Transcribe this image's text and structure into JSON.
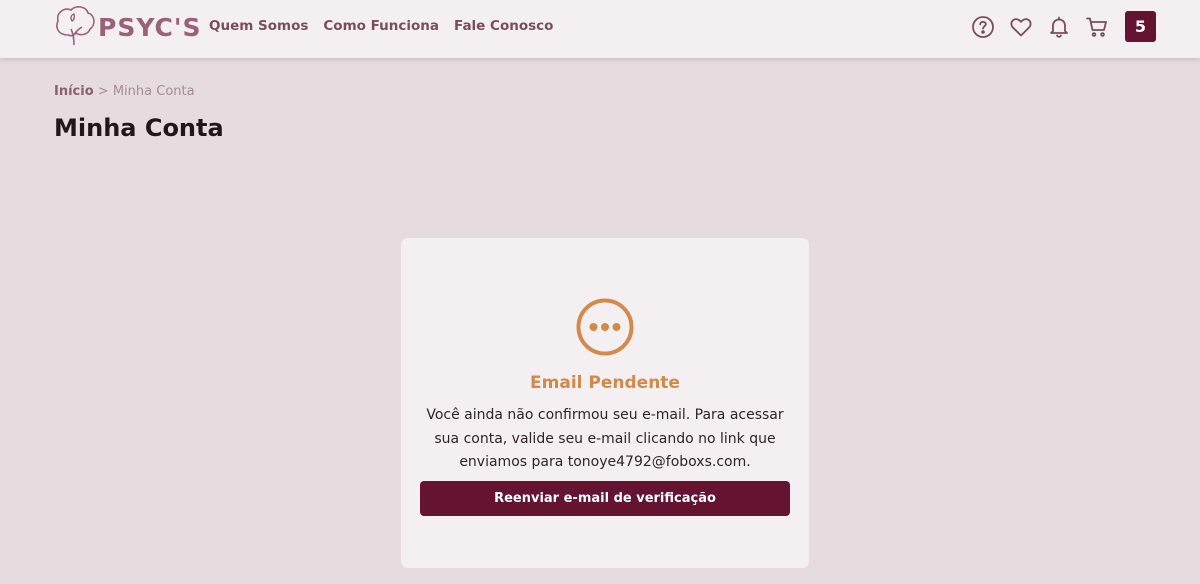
{
  "header": {
    "logo_text": "PSYC'S",
    "nav": [
      "Quem Somos",
      "Como Funciona",
      "Fale Conosco"
    ],
    "icons": [
      "help-icon",
      "heart-icon",
      "bell-icon",
      "cart-icon"
    ],
    "badge": "5"
  },
  "breadcrumb": {
    "home": "Início",
    "separator": ">",
    "current": "Minha Conta"
  },
  "page": {
    "title": "Minha Conta"
  },
  "card": {
    "icon": "pending-dots-icon",
    "title": "Email Pendente",
    "message": "Você ainda não confirmou seu e-mail. Para acessar sua conta, valide seu e-mail clicando no link que enviamos para tonoye4792@foboxs.com.",
    "button_label": "Reenviar e-mail de verificação"
  },
  "colors": {
    "brand": "#641431",
    "accent": "#d4894a",
    "logo": "#9a6178",
    "background": "#e6dbdf",
    "card": "#f4f0f1"
  }
}
